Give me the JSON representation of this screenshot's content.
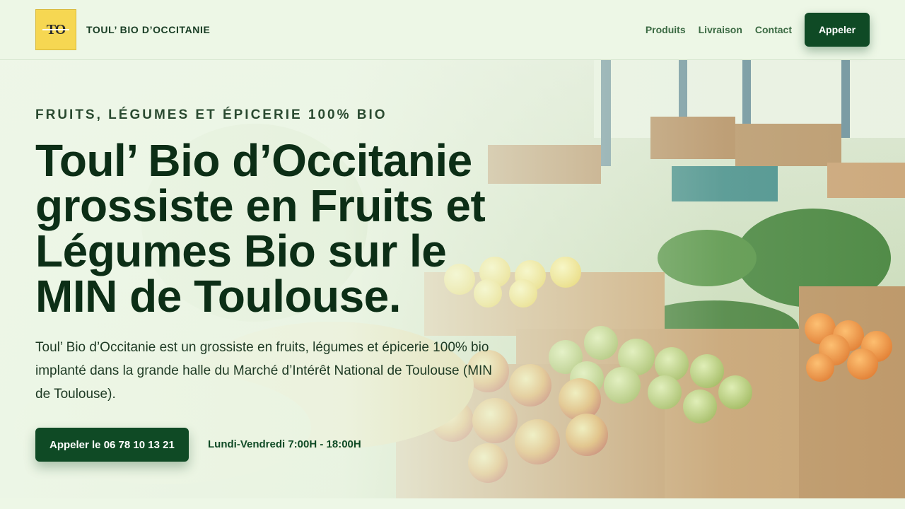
{
  "header": {
    "logo_alt": "TO",
    "brand": "TOUL’ BIO D’OCCITANIE",
    "nav": [
      "Produits",
      "Livraison",
      "Contact"
    ],
    "call_label": "Appeler"
  },
  "hero": {
    "eyebrow": "FRUITS, LÉGUMES ET ÉPICERIE 100% BIO",
    "title_lines": [
      "Toul’ Bio d’Occitanie",
      "grossiste en Fruits et",
      "Légumes Bio sur le",
      "MIN de Toulouse."
    ],
    "description": "Toul’ Bio d’Occitanie est un grossiste en fruits, légumes et épicerie 100% bio implanté dans la grande halle du Marché d’Intérêt National de Toulouse (MIN de Toulouse).",
    "cta_label": "Appeler le 06 78 10 13 21",
    "hours": "Lundi-Vendredi 7:00H - 18:00H"
  },
  "colors": {
    "primary": "#0f4a25",
    "background": "#eef7e8",
    "logo_bg": "#f6d752",
    "title": "#0c2e16"
  },
  "images": {
    "hero_background": "market-produce-crates-photo"
  }
}
